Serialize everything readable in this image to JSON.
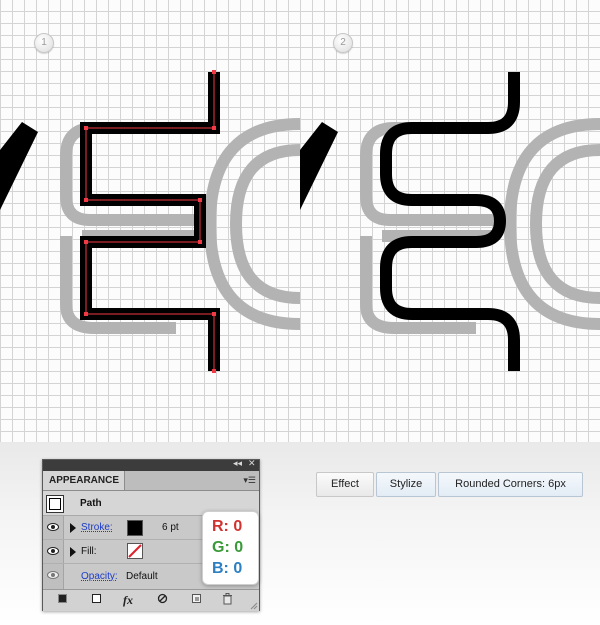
{
  "canvas": {
    "step_badges": [
      "1",
      "2"
    ],
    "path_stroke_color": "#000000",
    "anchor_color": "#f23a46",
    "ghost_letter_color": "#b3b3b3"
  },
  "appearance_panel": {
    "title": "APPEARANCE",
    "collapse_glyph": "◂◂",
    "close_glyph": "✕",
    "menu_glyph": "▾☰",
    "object_label": "Path",
    "stroke_label": "Stroke:",
    "stroke_color": "#000000",
    "stroke_weight": "6 pt",
    "fill_label": "Fill:",
    "fill_color": "none",
    "opacity_label": "Opacity:",
    "opacity_value": "Default",
    "footer_icons": [
      "new-art-icon",
      "add-stroke-icon",
      "fx-icon",
      "clear-appearance-icon",
      "duplicate-item-icon",
      "delete-item-icon"
    ],
    "fx_glyph": "fx"
  },
  "rgb_info": {
    "r_label": "R:",
    "r_value": "0",
    "r_color": "#d0332f",
    "g_label": "G:",
    "g_value": "0",
    "g_color": "#3a9a3a",
    "b_label": "B:",
    "b_value": "0",
    "b_color": "#2c7fc1"
  },
  "menu_path": {
    "items": [
      "Effect",
      "Stylize",
      "Rounded Corners: 6px"
    ]
  }
}
